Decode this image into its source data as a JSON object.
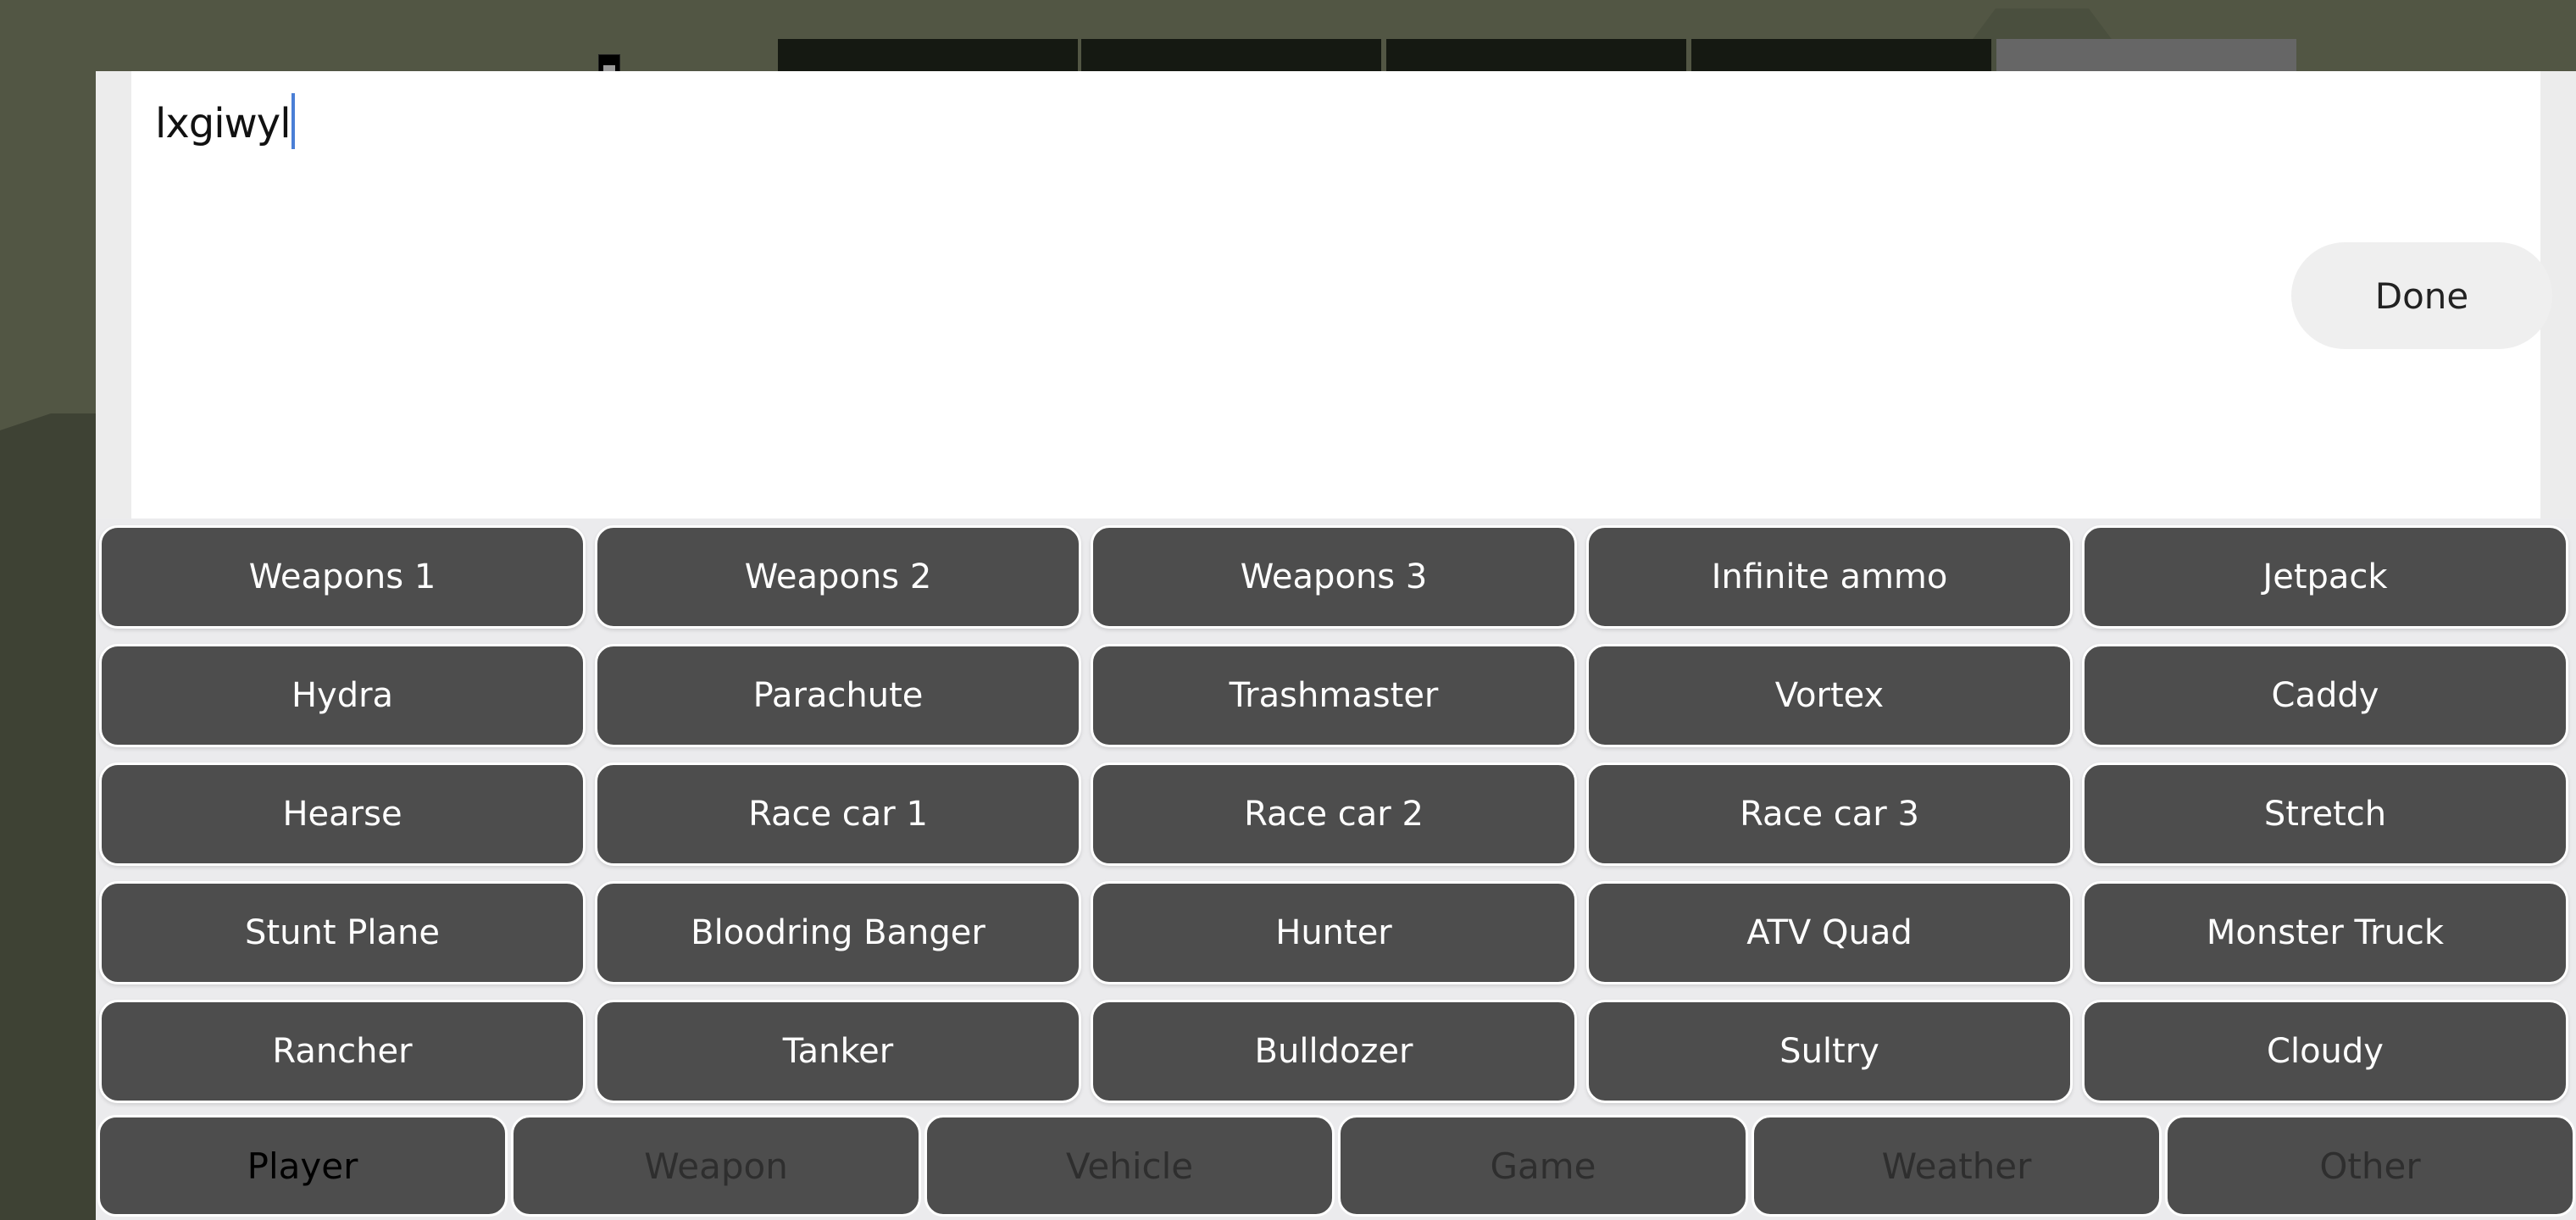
{
  "input": {
    "value": "lxgiwyl"
  },
  "done_button": {
    "label": "Done"
  },
  "cheats": [
    [
      "Weapons 1",
      "Weapons 2",
      "Weapons 3",
      "Infinite ammo",
      "Jetpack"
    ],
    [
      "Hydra",
      "Parachute",
      "Trashmaster",
      "Vortex",
      "Caddy"
    ],
    [
      "Hearse",
      "Race car 1",
      "Race car 2",
      "Race car 3",
      "Stretch"
    ],
    [
      "Stunt Plane",
      "Bloodring Banger",
      "Hunter",
      "ATV Quad",
      "Monster Truck"
    ],
    [
      "Rancher",
      "Tanker",
      "Bulldozer",
      "Sultry",
      "Cloudy"
    ]
  ],
  "tabs": [
    {
      "label": "Player",
      "active": true
    },
    {
      "label": "Weapon",
      "active": false
    },
    {
      "label": "Vehicle",
      "active": false
    },
    {
      "label": "Game",
      "active": false
    },
    {
      "label": "Weather",
      "active": false
    },
    {
      "label": "Other",
      "active": false
    }
  ],
  "colors": {
    "button_bg": "#4d4d4d",
    "button_text": "#ffffff",
    "tab_active_text": "#000000",
    "tab_inactive_text": "#2e2e2e",
    "caret": "#4a7fd6",
    "game_sky": "#525644",
    "game_ground": "#3e4234"
  }
}
